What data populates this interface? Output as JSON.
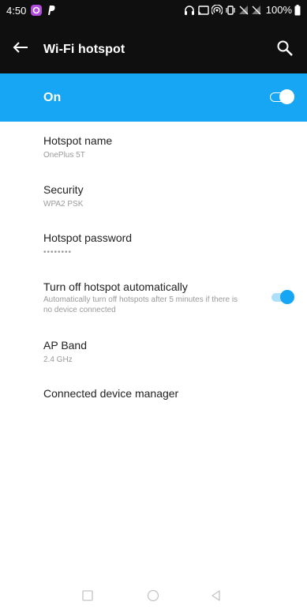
{
  "status_bar": {
    "time": "4:50",
    "battery_percent": "100%"
  },
  "app_bar": {
    "title": "Wi-Fi hotspot"
  },
  "master_switch": {
    "label": "On",
    "checked": true
  },
  "settings": [
    {
      "title": "Hotspot name",
      "summary": "OnePlus 5T"
    },
    {
      "title": "Security",
      "summary": "WPA2 PSK"
    },
    {
      "title": "Hotspot password",
      "summary": "••••••••"
    },
    {
      "title": "Turn off hotspot automatically",
      "summary": "Automatically turn off hotspots after 5 minutes if there is no device connected",
      "toggle_checked": true
    },
    {
      "title": "AP Band",
      "summary": "2.4 GHz"
    },
    {
      "title": "Connected device manager"
    }
  ],
  "colors": {
    "accent": "#16a6f4",
    "toolbar": "#0f0f0f"
  }
}
